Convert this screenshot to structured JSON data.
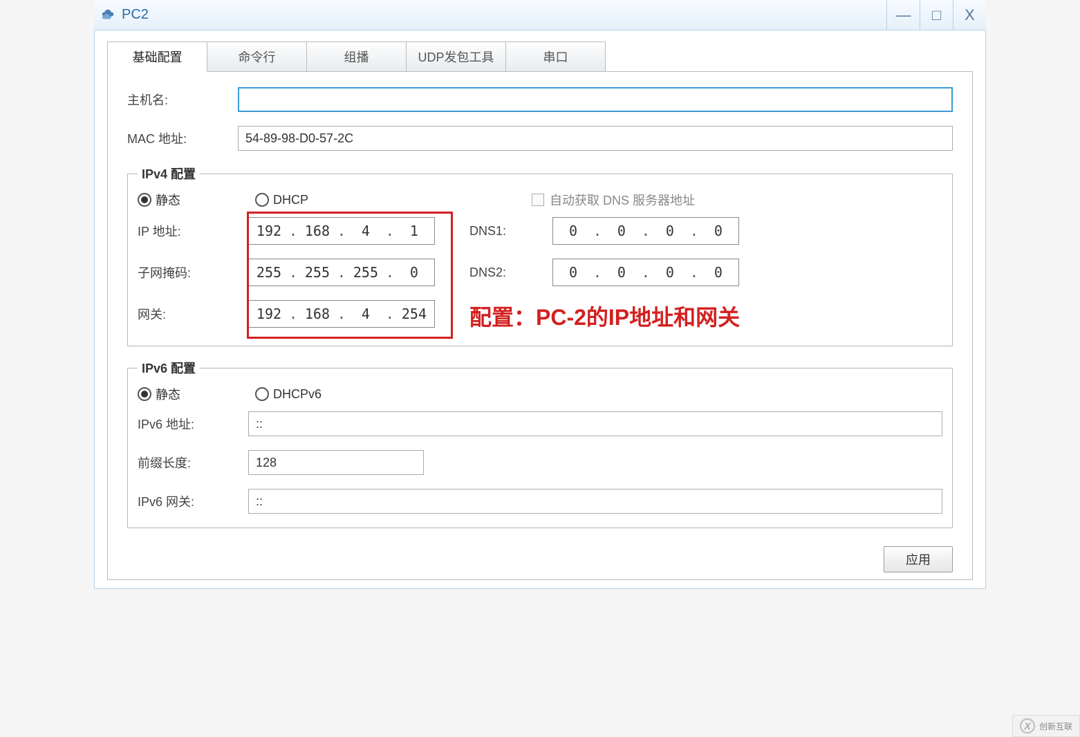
{
  "window": {
    "title": "PC2",
    "min": "—",
    "max": "□",
    "close": "X"
  },
  "tabs": [
    "基础配置",
    "命令行",
    "组播",
    "UDP发包工具",
    "串口"
  ],
  "active_tab_index": 0,
  "basic": {
    "hostname_label": "主机名:",
    "hostname_value": "",
    "mac_label": "MAC 地址:",
    "mac_value": "54-89-98-D0-57-2C"
  },
  "ipv4": {
    "legend": "IPv4 配置",
    "static_label": "静态",
    "dhcp_label": "DHCP",
    "auto_dns_label": "自动获取 DNS 服务器地址",
    "ip_label": "IP 地址:",
    "ip": [
      "192",
      "168",
      "4",
      "1"
    ],
    "mask_label": "子网掩码:",
    "mask": [
      "255",
      "255",
      "255",
      "0"
    ],
    "gw_label": "网关:",
    "gw": [
      "192",
      "168",
      "4",
      "254"
    ],
    "dns1_label": "DNS1:",
    "dns1": [
      "0",
      "0",
      "0",
      "0"
    ],
    "dns2_label": "DNS2:",
    "dns2": [
      "0",
      "0",
      "0",
      "0"
    ]
  },
  "annotation": "配置：PC-2的IP地址和网关",
  "ipv6": {
    "legend": "IPv6 配置",
    "static_label": "静态",
    "dhcpv6_label": "DHCPv6",
    "addr_label": "IPv6 地址:",
    "addr_value": "::",
    "prefix_label": "前缀长度:",
    "prefix_value": "128",
    "gw_label": "IPv6 网关:",
    "gw_value": "::"
  },
  "apply_label": "应用",
  "watermark": "创新互联"
}
